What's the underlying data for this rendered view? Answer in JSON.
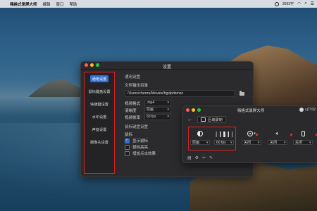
{
  "menubar": {
    "app_name": "嗨格式录屏大师",
    "items": [
      "编辑",
      "窗口",
      "帮助"
    ],
    "right": {
      "size_text": "3093字"
    }
  },
  "settings": {
    "title": "设置",
    "sidebar": [
      {
        "label": "通用设置",
        "active": true
      },
      {
        "label": "鼠标键盘设置",
        "active": false
      },
      {
        "label": "快捷键设置",
        "active": false
      },
      {
        "label": "水印设置",
        "active": false
      },
      {
        "label": "声音设置",
        "active": false
      },
      {
        "label": "摄像头设置",
        "active": false
      }
    ],
    "general": {
      "section": "通用设置",
      "output_dir_label": "文件输出目录",
      "output_dir_value": "/Users/chenru/Movies/hgxlpdsmac",
      "video_format_label": "视频格式",
      "video_format_value": ".mp4",
      "quality_label": "清晰度",
      "quality_value": "原画",
      "fps_label": "视频帧率",
      "fps_value": "60 fps"
    },
    "mouse": {
      "section": "鼠标键盘设置",
      "sub": "鼠标",
      "show_cursor": "显示鼠标",
      "highlight_cursor": "鼠标高亮",
      "click_effect": "增加点击效果"
    }
  },
  "recorder": {
    "app_name": "嗨格式录屏大师",
    "user": "cj7702",
    "mode": "区域录制",
    "controls": [
      {
        "name": "quality",
        "value": "原画"
      },
      {
        "name": "fps",
        "value": "60 fps"
      },
      {
        "name": "camera",
        "value": "关闭"
      },
      {
        "name": "system-audio",
        "value": "关闭"
      },
      {
        "name": "microphone",
        "value": "关闭"
      }
    ]
  }
}
